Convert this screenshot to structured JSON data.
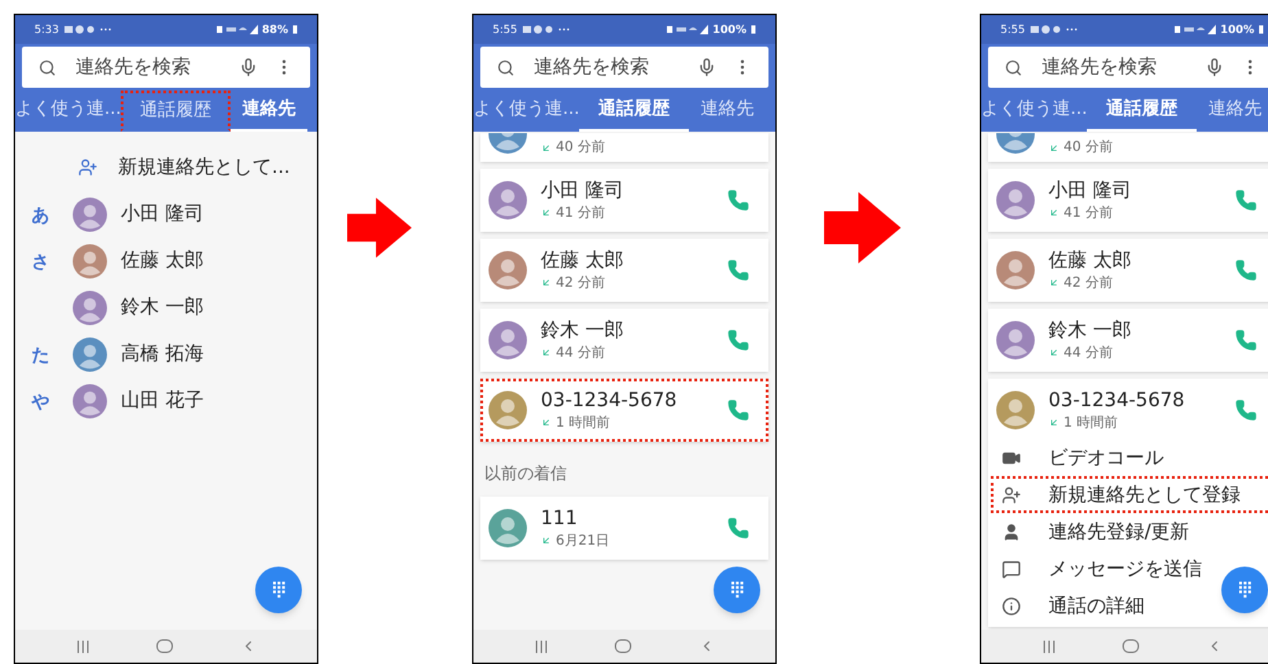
{
  "phones": [
    {
      "status_bar": {
        "time": "5:33",
        "battery": "88%"
      },
      "search": {
        "placeholder": "連絡先を検索"
      },
      "tabs": [
        {
          "label": "よく使う連...",
          "selected": false,
          "highlighted": false
        },
        {
          "label": "通話履歴",
          "selected": false,
          "highlighted": true
        },
        {
          "label": "連絡先",
          "selected": true,
          "highlighted": false
        }
      ],
      "items": [
        {
          "kind": "action",
          "label": "新規連絡先として..."
        },
        {
          "kind": "contact",
          "index": "あ",
          "name": "小田 隆司",
          "color": "#9b84b8"
        },
        {
          "kind": "contact",
          "index": "さ",
          "name": "佐藤 太郎",
          "color": "#b88a78"
        },
        {
          "kind": "contact",
          "name": "鈴木 一郎",
          "color": "#9b84b8"
        },
        {
          "kind": "contact",
          "index": "た",
          "name": "高橋 拓海",
          "color": "#5b8fbf"
        },
        {
          "kind": "contact",
          "index": "や",
          "name": "山田 花子",
          "color": "#9b84b8"
        }
      ]
    },
    {
      "status_bar": {
        "time": "5:55",
        "battery": "100%"
      },
      "search": {
        "placeholder": "連絡先を検索"
      },
      "tabs": [
        {
          "label": "よく使う連...",
          "selected": false,
          "highlighted": false
        },
        {
          "label": "通話履歴",
          "selected": true,
          "highlighted": false
        },
        {
          "label": "連絡先",
          "selected": false,
          "highlighted": false
        }
      ],
      "items": [
        {
          "kind": "call_partial",
          "time": "40 分前",
          "color": "#5b8fbf"
        },
        {
          "kind": "call",
          "name": "小田 隆司",
          "time": "41 分前",
          "color": "#9b84b8",
          "highlighted": false
        },
        {
          "kind": "call",
          "name": "佐藤 太郎",
          "time": "42 分前",
          "color": "#b88a78",
          "highlighted": false
        },
        {
          "kind": "call",
          "name": "鈴木 一郎",
          "time": "44 分前",
          "color": "#9b84b8",
          "highlighted": false
        },
        {
          "kind": "call",
          "name": "03-1234-5678",
          "time": "1 時間前",
          "color": "#b59a5e",
          "highlighted": true
        },
        {
          "kind": "section",
          "label": "以前の着信"
        },
        {
          "kind": "call",
          "name": "111",
          "time": "6月21日",
          "color": "#5aa39a",
          "highlighted": false
        }
      ]
    },
    {
      "status_bar": {
        "time": "5:55",
        "battery": "100%"
      },
      "search": {
        "placeholder": "連絡先を検索"
      },
      "tabs": [
        {
          "label": "よく使う連...",
          "selected": false,
          "highlighted": false
        },
        {
          "label": "通話履歴",
          "selected": true,
          "highlighted": false
        },
        {
          "label": "連絡先",
          "selected": false,
          "highlighted": false
        }
      ],
      "items": [
        {
          "kind": "call_partial",
          "time": "40 分前",
          "color": "#5b8fbf"
        },
        {
          "kind": "call",
          "name": "小田 隆司",
          "time": "41 分前",
          "color": "#9b84b8",
          "highlighted": false
        },
        {
          "kind": "call",
          "name": "佐藤 太郎",
          "time": "42 分前",
          "color": "#b88a78",
          "highlighted": false
        },
        {
          "kind": "call",
          "name": "鈴木 一郎",
          "time": "44 分前",
          "color": "#9b84b8",
          "highlighted": false
        },
        {
          "kind": "call",
          "name": "03-1234-5678",
          "time": "1 時間前",
          "color": "#b59a5e",
          "highlighted": false,
          "menu": [
            {
              "kind": "video",
              "label": "ビデオコール",
              "highlighted": false
            },
            {
              "kind": "add_contact",
              "label": "新規連絡先として登録",
              "highlighted": true
            },
            {
              "kind": "contact",
              "label": "連絡先登録/更新",
              "highlighted": false
            },
            {
              "kind": "message",
              "label": "メッセージを送信",
              "highlighted": false
            },
            {
              "kind": "info",
              "label": "通話の詳細",
              "highlighted": false
            }
          ]
        }
      ]
    }
  ]
}
